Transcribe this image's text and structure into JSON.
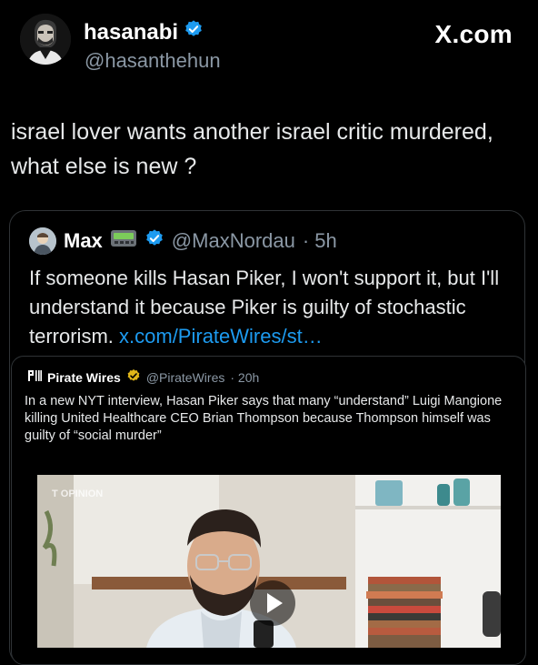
{
  "author": {
    "name": "hasanabi",
    "handle": "@hasanthehun"
  },
  "brand": "X.com",
  "tweet": {
    "text": "israel lover wants another israel critic murdered, what else is new ?"
  },
  "quote1": {
    "name": "Max",
    "handle": "@MaxNordau",
    "time": "· 5h",
    "text": "If someone kills Hasan Piker, I won't support it, but I'll understand it because Piker is guilty of stochastic terrorism.",
    "link": "x.com/PirateWires/st…"
  },
  "quote2": {
    "logo": "PW",
    "name": "Pirate Wires",
    "handle": "@PirateWires",
    "time": "· 20h",
    "text": "In a new NYT interview, Hasan Piker says that many “understand” Luigi Mangione killing United Healthcare CEO Brian Thompson because Thompson himself was guilty of “social murder”",
    "video_watermark": "T OPINION"
  },
  "colors": {
    "background": "#000000",
    "text": "#e7e9ea",
    "muted": "#8b98a5",
    "link": "#1d9bf0",
    "verified_blue": "#1d9bf0",
    "verified_gold": "#e2b719",
    "border": "#2f3336"
  },
  "icons": [
    "verified-badge-icon",
    "pager-emoji-icon",
    "gold-verified-icon",
    "play-icon"
  ]
}
